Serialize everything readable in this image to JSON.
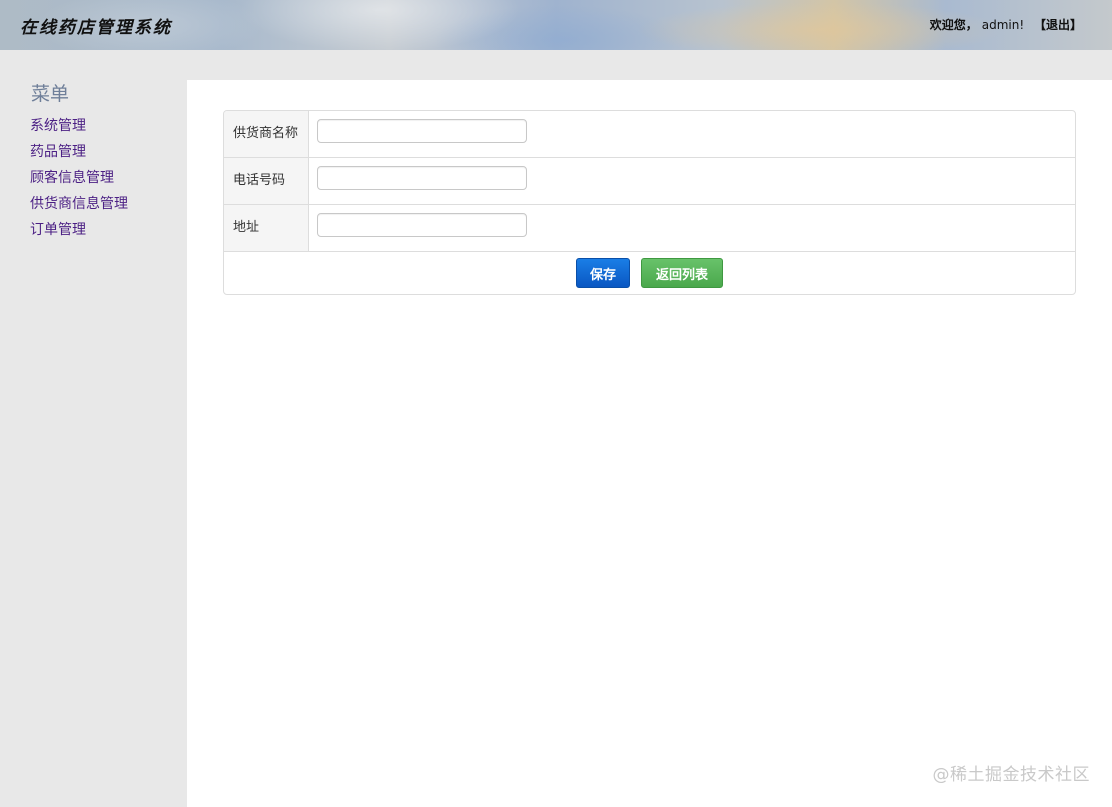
{
  "header": {
    "title": "在线药店管理系统",
    "welcome": "欢迎您，",
    "username": "admin!",
    "logout_label": "【退出】"
  },
  "sidebar": {
    "title": "菜单",
    "items": [
      {
        "label": "系统管理"
      },
      {
        "label": "药品管理"
      },
      {
        "label": "顾客信息管理"
      },
      {
        "label": "供货商信息管理"
      },
      {
        "label": "订单管理"
      }
    ]
  },
  "form": {
    "fields": [
      {
        "label": "供货商名称",
        "value": ""
      },
      {
        "label": "电话号码",
        "value": ""
      },
      {
        "label": "地址",
        "value": ""
      }
    ],
    "save_label": "保存",
    "back_label": "返回列表"
  },
  "watermark": "@稀土掘金技术社区",
  "colors": {
    "sidebar_bg": "#e8e8e8",
    "menu_link": "#4b1f84",
    "save_button": "#0a57c2",
    "back_button": "#4aa84c"
  }
}
